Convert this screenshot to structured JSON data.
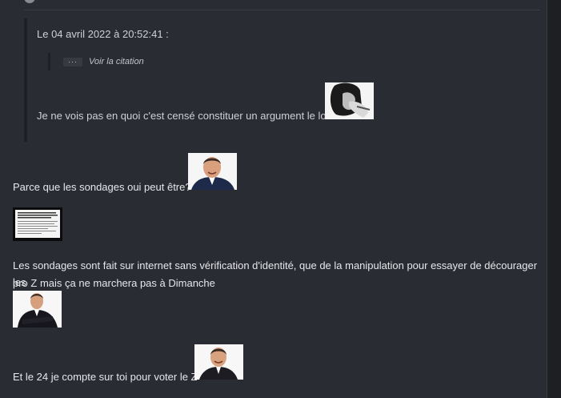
{
  "quote": {
    "header": "Le 04 avril 2022 à 20:52:41 :",
    "collapsed_dots": "···",
    "show_quote_label": "Voir la citation",
    "text": "Je ne vois pas en quoi c'est censé constituer un argument le low"
  },
  "message": {
    "line1": "Parce que les sondages oui peut être?",
    "line2a": "Les sondages sont fait sur internet sans vérification d'identité, que de la manipulation pour essayer de décourager les",
    "line2b": "pro Z mais ça ne marchera pas à Dimanche",
    "line3": "Et le 24 je compte sur toi pour voter le Z"
  },
  "colors": {
    "background": "#2a2c33",
    "text": "#e6e7ea",
    "quote_border": "#1f2025"
  }
}
